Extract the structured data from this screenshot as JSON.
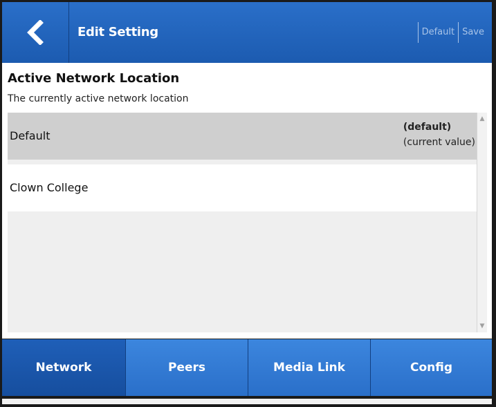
{
  "header": {
    "back_icon": "chevron-left-icon",
    "title": "Edit Setting",
    "actions": [
      "Default",
      "Save"
    ]
  },
  "setting": {
    "title": "Active Network Location",
    "description": "The currently active network location"
  },
  "options": [
    {
      "label": "Default",
      "tag": "(default)",
      "note": "(current value)",
      "selected": true
    },
    {
      "label": "Clown College",
      "selected": false
    }
  ],
  "tabs": [
    {
      "label": "Network",
      "active": true
    },
    {
      "label": "Peers",
      "active": false
    },
    {
      "label": "Media Link",
      "active": false
    },
    {
      "label": "Config",
      "active": false
    }
  ],
  "colors": {
    "accent": "#2a6fc9",
    "accent_dark": "#1c5bb0",
    "selected_row": "#cfcfcf",
    "list_background": "#efefef"
  }
}
